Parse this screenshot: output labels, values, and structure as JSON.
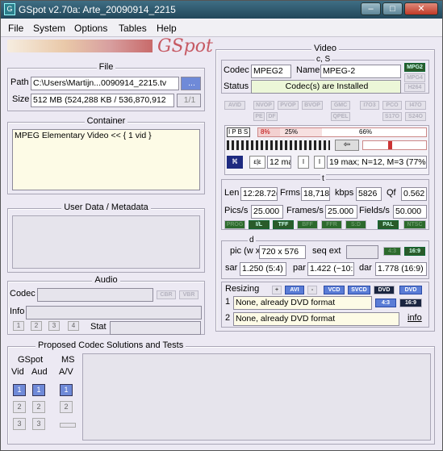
{
  "titlebar": {
    "title": "GSpot v2.70a: Arte_20090914_2215",
    "minimize": "–",
    "maximize": "□",
    "close": "✕"
  },
  "menu": [
    "File",
    "System",
    "Options",
    "Tables",
    "Help"
  ],
  "logo": "GSpot",
  "file": {
    "group": "File",
    "path_label": "Path",
    "path_value": "C:\\Users\\Martijn...0090914_2215.tv",
    "browse": "...",
    "size_label": "Size",
    "size_value": "512 MB (524,288 KB / 536,870,912",
    "page": "1/1"
  },
  "container": {
    "group": "Container",
    "value": "MPEG Elementary Video << { 1 vid }"
  },
  "userdata": {
    "group": "User Data / Metadata"
  },
  "audio": {
    "group": "Audio",
    "codec_label": "Codec",
    "cbr": "CBR",
    "vbr": "VBR",
    "info_label": "Info",
    "stat_label": "Stat",
    "streams": [
      "1",
      "2",
      "3",
      "4"
    ]
  },
  "proposed": {
    "group": "Proposed Codec Solutions and Tests",
    "gspot": "GSpot",
    "vid": "Vid",
    "aud": "Aud",
    "ms": "MS",
    "av": "A/V",
    "nums": [
      "1",
      "2",
      "3"
    ]
  },
  "video": {
    "group": "Video",
    "cs": "c, S",
    "codec_label": "Codec",
    "codec_value": "MPEG2",
    "name_label": "Name",
    "name_value": "MPEG-2",
    "status_label": "Status",
    "status_value": "Codec(s) are Installed",
    "badges": [
      "MPG2",
      "MPG4",
      "H264"
    ],
    "row1": [
      "AVID",
      "NVOP",
      "PVOP",
      "BVOP",
      "GMC",
      "I7O3",
      "PCO",
      "I47O"
    ],
    "row2": [
      "PE",
      "DF",
      "QPEL",
      "S17O",
      "S24O"
    ],
    "frames": [
      "I",
      "P",
      "B",
      "S"
    ],
    "pct1": "8%",
    "pct2": "25%",
    "pct3": "66%",
    "gop": "12 ma",
    "gopinfo": "19 max; N=12, M=3 (77%",
    "t": "t",
    "len_label": "Len",
    "len_value": "12:28.72(",
    "frms_label": "Frms",
    "frms_value": "18,718",
    "kbps_label": "kbps",
    "kbps_value": "5826",
    "qf_label": "Qf",
    "qf_value": "0.562",
    "pics_label": "Pics/s",
    "pics_value": "25.000",
    "frames_label": "Frames/s",
    "frames_value": "25.000",
    "fields_label": "Fields/s",
    "fields_value": "50.000",
    "flags": [
      "PROG",
      "I/L",
      "TFF",
      "BFF",
      "FFR",
      "S:D",
      "PAL",
      "NTSC"
    ],
    "d": "d",
    "pic_label": "pic (w x",
    "pic_value": "720 x 576",
    "seqext_label": "seq ext",
    "b1": "4:3",
    "b2": "16:9",
    "sar_label": "sar",
    "sar_value": "1.250 (5:4)",
    "par_label": "par",
    "par_value": "1.422 (~10:",
    "dar_label": "dar",
    "dar_value": "1.778 (16:9)",
    "resizing_label": "Resizing",
    "resize_btns": [
      "+",
      "AVI",
      "-",
      "VCD",
      "SVCD",
      "DVD",
      "DVD"
    ],
    "r1_label": "1",
    "r1_value": "None, already DVD format",
    "r1a": "4:3",
    "r1b": "16:9",
    "r2_label": "2",
    "r2_value": "None, already DVD format",
    "info": "info"
  }
}
